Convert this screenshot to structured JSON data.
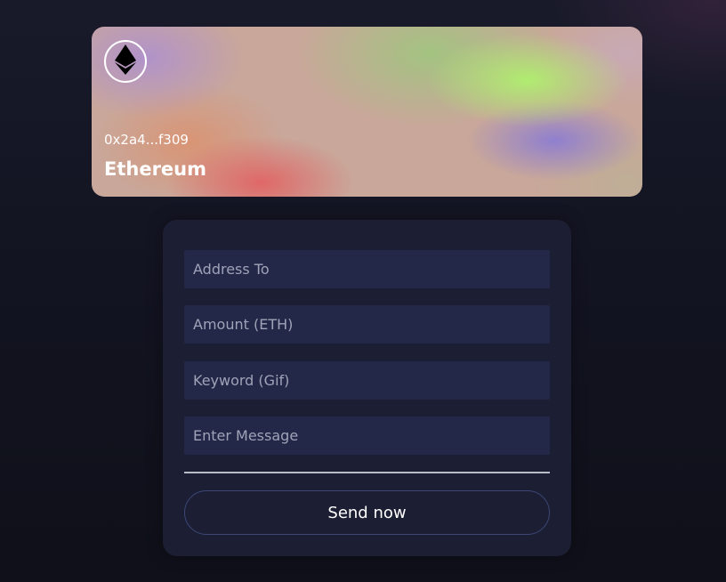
{
  "card": {
    "address": "0x2a4...f309",
    "network_name": "Ethereum",
    "logo_icon": "ethereum-icon"
  },
  "form": {
    "address_placeholder": "Address To",
    "amount_placeholder": "Amount (ETH)",
    "keyword_placeholder": "Keyword (Gif)",
    "message_placeholder": "Enter Message",
    "send_label": "Send now"
  },
  "colors": {
    "background": "#131420",
    "panel": "#1c1e33",
    "input": "#242848",
    "button_border": "#3c4778",
    "text": "#ffffff",
    "placeholder": "#9ea3b8"
  }
}
